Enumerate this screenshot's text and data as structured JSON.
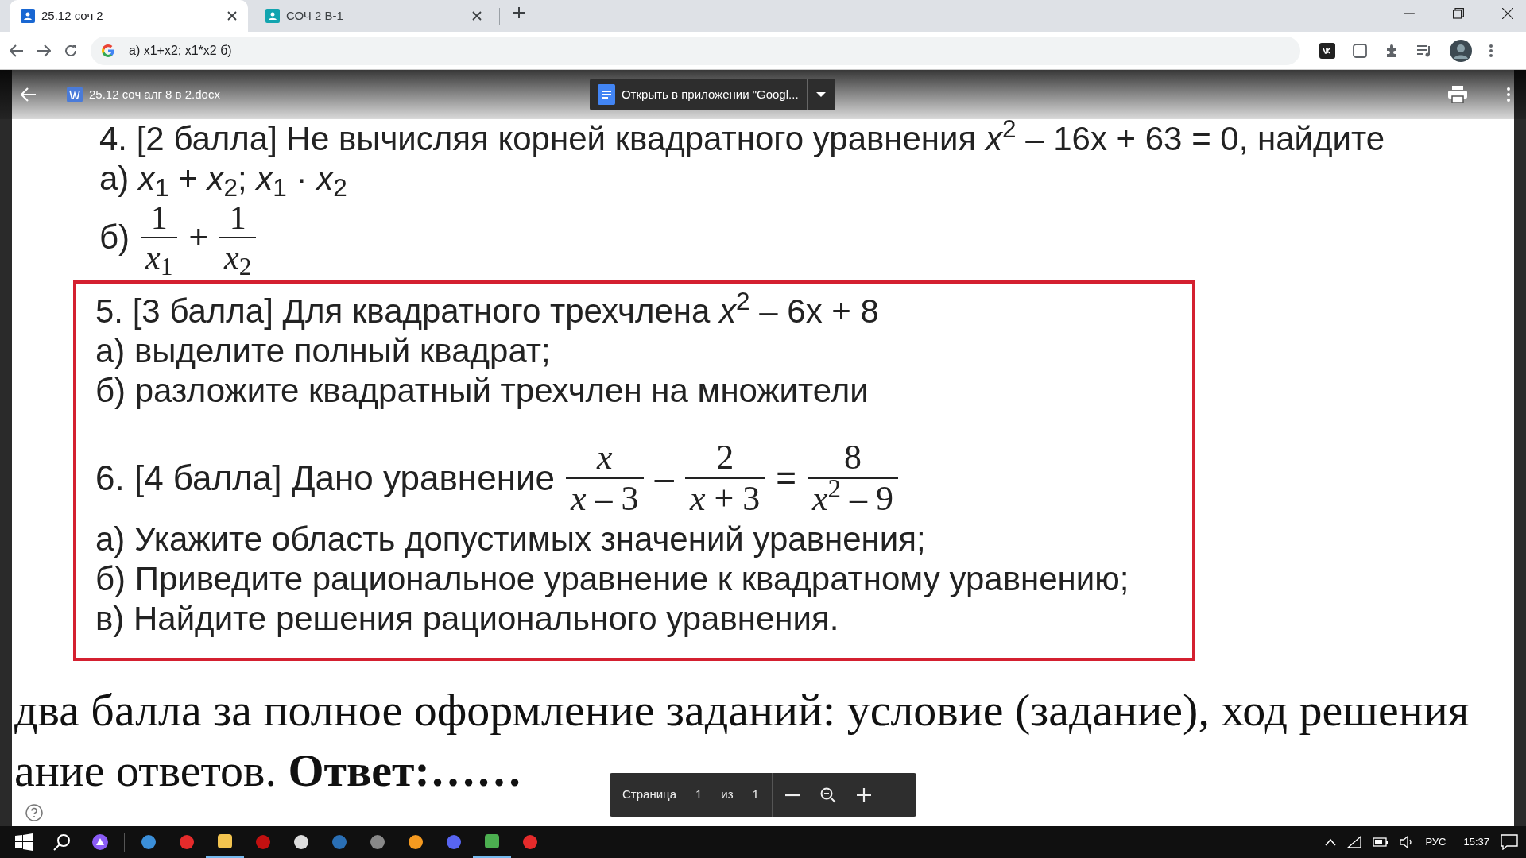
{
  "browser": {
    "tabs": [
      {
        "title": "25.12 соч 2",
        "selected": true
      },
      {
        "title": "СОЧ 2 В-1",
        "selected": false
      }
    ],
    "address": "а) x1+x2; x1*x2 б)"
  },
  "viewer": {
    "file_name": "25.12 соч алг 8 в 2.docx",
    "open_button": "Открыть в приложении \"Googl...",
    "page_label": "Страница",
    "page_current": "1",
    "page_of": "из",
    "page_total": "1"
  },
  "document": {
    "lines": [
      {
        "kind": "text",
        "text": "4. [2 балла] Не вычисляя корней квадратного уравнения *x*$^{2}$ – 16x + 63 = 0, найдите"
      },
      {
        "kind": "text",
        "text": "а) *x*$_{1}$ + *x*$_{2}$;  *x*$_{1}$ · *x*$_{2}$"
      },
      {
        "kind": "formula",
        "parts": [
          {
            "kind": "text",
            "text": "б)"
          },
          {
            "kind": "fraction",
            "num": "1",
            "den": "*x*$_{1}$"
          },
          {
            "kind": "text",
            "text": "+"
          },
          {
            "kind": "fraction",
            "num": "1",
            "den": "*x*$_{2}$"
          }
        ]
      }
    ],
    "boxed_lines": [
      {
        "kind": "text",
        "text": "5. [3 балла]  Для квадратного трехчлена *x*$^{2}$ – 6x + 8"
      },
      {
        "kind": "text",
        "text": "а) выделите полный квадрат;"
      },
      {
        "kind": "text",
        "text": "б) разложите квадратный трехчлен на множители"
      },
      {
        "kind": "formula",
        "parts": [
          {
            "kind": "text",
            "text": "6. [4 балла]   Дано уравнение"
          },
          {
            "kind": "fraction",
            "num": "*x*",
            "den": "*x* – 3"
          },
          {
            "kind": "text",
            "text": "–"
          },
          {
            "kind": "fraction",
            "num": "2",
            "den": "*x* + 3"
          },
          {
            "kind": "text",
            "text": "="
          },
          {
            "kind": "fraction",
            "num": "8",
            "den": "*x*$^{2}$ – 9"
          }
        ]
      },
      {
        "kind": "text",
        "text": "а) Укажите область допустимых значений уравнения;"
      },
      {
        "kind": "text",
        "text": "б) Приведите рациональное уравнение к квадратному уравнению;"
      },
      {
        "kind": "text",
        "text": "в) Найдите решения рационального уравнения."
      }
    ],
    "footer_lines": [
      {
        "kind": "text",
        "text": "два балла за полное оформление заданий: условие (задание), ход решения"
      },
      {
        "kind": "text",
        "text": "ание ответов.  **Ответ:……**"
      }
    ]
  },
  "taskbar": {
    "language": "РУС",
    "time": "15:37"
  }
}
